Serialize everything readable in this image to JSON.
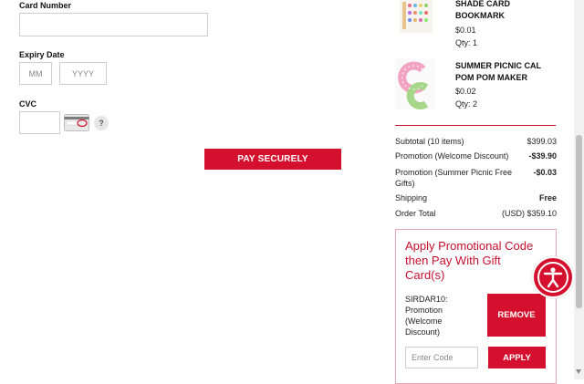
{
  "form": {
    "card_number_label": "Card Number",
    "expiry_label": "Expiry Date",
    "expiry_month_placeholder": "MM",
    "expiry_year_placeholder": "YYYY",
    "cvc_label": "CVC",
    "cvc_help": "?",
    "pay_button": "PAY SECURELY"
  },
  "cart_items": [
    {
      "name_line1": "SHADE CARD",
      "name_line2": "BOOKMARK",
      "price": "$0.01",
      "qty": "Qty: 1"
    },
    {
      "name_line1": "SUMMER PICNIC CAL",
      "name_line2": "POM POM MAKER",
      "price": "$0.02",
      "qty": "Qty: 2"
    }
  ],
  "summary": {
    "subtotal_label": "Subtotal (10 items)",
    "subtotal_value": "$399.03",
    "promo1_label": "Promotion (Welcome Discount)",
    "promo1_value": "-$39.90",
    "promo2_label_line1": "Promotion (Summer Picnic Free",
    "promo2_label_line2": "Gifts)",
    "promo2_value": "-$0.03",
    "shipping_label": "Shipping",
    "shipping_value": "Free",
    "total_label": "Order Total",
    "total_value": "(USD) $359.10"
  },
  "promo": {
    "title_line1": "Apply Promotional Code",
    "title_line2": "then Pay With Gift",
    "title_line3": "Card(s)",
    "applied_code_line1": "SIRDAR10:",
    "applied_code_line2": "Promotion",
    "applied_code_line3": "(Welcome",
    "applied_code_line4": "Discount)",
    "remove_button": "REMOVE",
    "code_placeholder": "Enter Code",
    "apply_button": "APPLY"
  },
  "accessibility": {
    "icon": "accessibility-icon"
  },
  "colors": {
    "accent": "#d4102e",
    "divider": "#c8102e"
  }
}
